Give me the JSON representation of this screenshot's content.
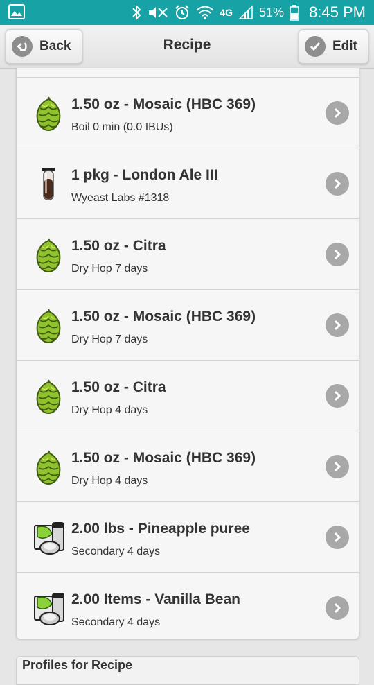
{
  "status_bar": {
    "battery": "51%",
    "time": "8:45 PM",
    "network": "4G",
    "icons": [
      "gallery-icon",
      "bluetooth-icon",
      "mute-icon",
      "alarm-icon",
      "wifi-icon",
      "signal-icon",
      "battery-icon"
    ],
    "color": "#17a2a6"
  },
  "header": {
    "back_label": "Back",
    "title": "Recipe",
    "edit_label": "Edit"
  },
  "ingredients": [
    {
      "title": "1.50 oz - Mosaic (HBC 369)",
      "sub": "Boil 0 min (0.0 IBUs)",
      "icon": "hop-icon"
    },
    {
      "title": "1 pkg - London Ale III",
      "sub": "Wyeast Labs #1318",
      "icon": "yeast-vial-icon"
    },
    {
      "title": "1.50 oz - Citra",
      "sub": "Dry Hop 7 days",
      "icon": "hop-icon"
    },
    {
      "title": "1.50 oz - Mosaic (HBC 369)",
      "sub": "Dry Hop 7 days",
      "icon": "hop-icon"
    },
    {
      "title": "1.50 oz - Citra",
      "sub": "Dry Hop 4 days",
      "icon": "hop-icon"
    },
    {
      "title": "1.50 oz - Mosaic (HBC 369)",
      "sub": "Dry Hop 4 days",
      "icon": "hop-icon"
    },
    {
      "title": "2.00 lbs - Pineapple puree",
      "sub": "Secondary 4 days",
      "icon": "misc-ingredient-icon"
    },
    {
      "title": "2.00 Items - Vanilla Bean",
      "sub": "Secondary 4 days",
      "icon": "misc-ingredient-icon"
    }
  ],
  "profiles_section": {
    "title": "Profiles for Recipe"
  }
}
